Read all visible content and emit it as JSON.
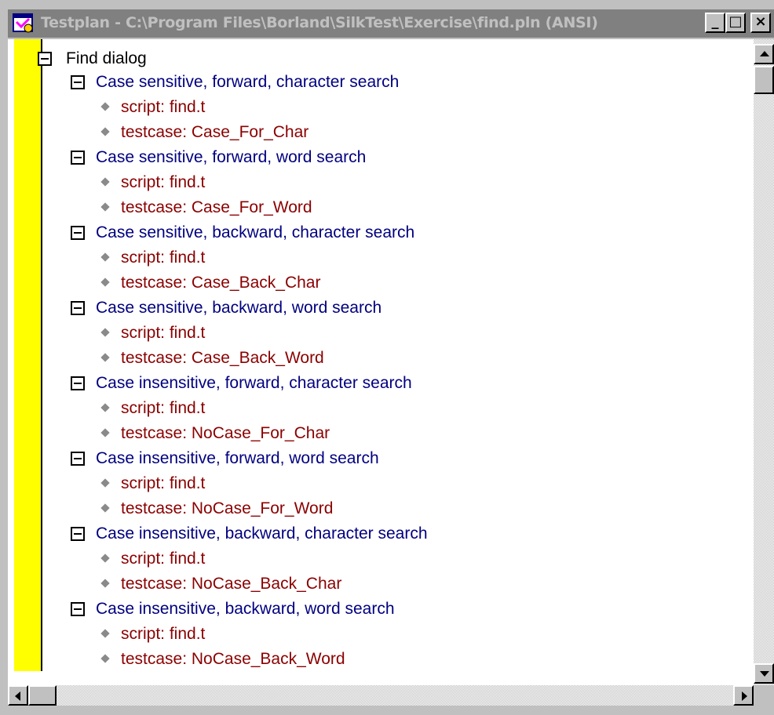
{
  "window": {
    "title": "Testplan - C:\\Program Files\\Borland\\SilkTest\\Exercise\\find.pln (ANSI)",
    "minimize_label": "_",
    "maximize_label": "□",
    "close_label": "×"
  },
  "tree": {
    "root_label": "Find dialog",
    "groups": [
      {
        "label": "Case sensitive, forward, character search",
        "script": "script: find.t",
        "testcase": "testcase: Case_For_Char"
      },
      {
        "label": "Case sensitive, forward, word search",
        "script": "script: find.t",
        "testcase": "testcase: Case_For_Word"
      },
      {
        "label": "Case sensitive, backward, character search",
        "script": "script: find.t",
        "testcase": "testcase: Case_Back_Char"
      },
      {
        "label": "Case sensitive, backward, word search",
        "script": "script: find.t",
        "testcase": "testcase: Case_Back_Word"
      },
      {
        "label": "Case insensitive, forward, character search",
        "script": "script: find.t",
        "testcase": "testcase: NoCase_For_Char"
      },
      {
        "label": "Case insensitive, forward, word search",
        "script": "script: find.t",
        "testcase": "testcase: NoCase_For_Word"
      },
      {
        "label": "Case insensitive, backward, character search",
        "script": "script: find.t",
        "testcase": "testcase: NoCase_Back_Char"
      },
      {
        "label": "Case insensitive, backward, word search",
        "script": "script: find.t",
        "testcase": "testcase: NoCase_Back_Word"
      }
    ]
  },
  "colors": {
    "title_bar": "#808080",
    "gutter": "#ffff00",
    "group_text": "#000080",
    "attribute_text": "#8b0000"
  }
}
